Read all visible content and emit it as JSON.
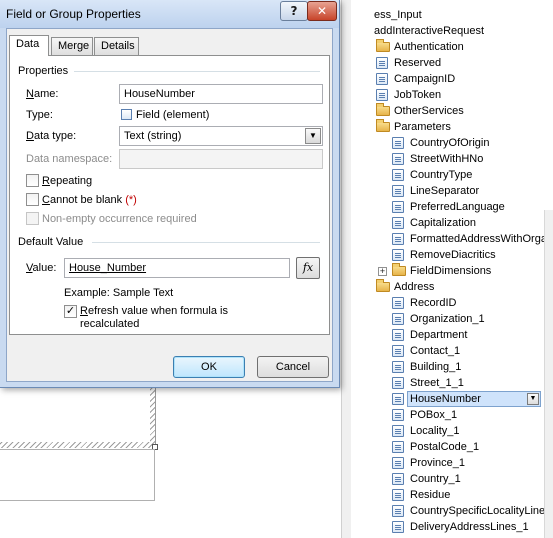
{
  "dialog": {
    "title": "Field or Group Properties",
    "help_glyph": "?",
    "close_glyph": "✕",
    "tabs": [
      "Data",
      "Merge",
      "Details"
    ],
    "properties_header": "Properties",
    "name": {
      "label_u": "N",
      "label_rest": "ame:",
      "value": "HouseNumber"
    },
    "type": {
      "label": "Type:",
      "value": "Field (element)"
    },
    "data_type": {
      "label_u": "D",
      "label_rest": "ata type:",
      "value": "Text (string)"
    },
    "data_namespace": {
      "label": "Data namespace:",
      "value": ""
    },
    "repeating": {
      "label_u": "R",
      "label_rest": "epeating",
      "checked": false
    },
    "cannot_be_blank": {
      "label_u": "C",
      "label_rest": "annot be blank",
      "marker": "(*)",
      "checked": false
    },
    "non_empty": {
      "label": "Non-empty occurrence required",
      "checked": false
    },
    "default_value_header": "Default Value",
    "value": {
      "label_u": "V",
      "label_rest": "alue:",
      "value": "House_Number"
    },
    "fx_label": "fx",
    "example": "Example: Sample Text",
    "refresh": {
      "label_u": "R",
      "label_rest": "efresh value when formula is recalculated",
      "checked": true
    },
    "ok_label": "OK",
    "cancel_label": "Cancel"
  },
  "tree": {
    "items": [
      {
        "label": "ess_Input",
        "icon": "none",
        "level": 0
      },
      {
        "label": "addInteractiveRequest",
        "icon": "none",
        "level": 0
      },
      {
        "label": "Authentication",
        "icon": "folder",
        "level": 0
      },
      {
        "label": "Reserved",
        "icon": "field",
        "level": 0
      },
      {
        "label": "CampaignID",
        "icon": "field",
        "level": 0
      },
      {
        "label": "JobToken",
        "icon": "field",
        "level": 0
      },
      {
        "label": "OtherServices",
        "icon": "folder",
        "level": 0
      },
      {
        "label": "Parameters",
        "icon": "folder",
        "level": 0
      },
      {
        "label": "CountryOfOrigin",
        "icon": "field",
        "level": 1
      },
      {
        "label": "StreetWithHNo",
        "icon": "field",
        "level": 1
      },
      {
        "label": "CountryType",
        "icon": "field",
        "level": 1
      },
      {
        "label": "LineSeparator",
        "icon": "field",
        "level": 1
      },
      {
        "label": "PreferredLanguage",
        "icon": "field",
        "level": 1
      },
      {
        "label": "Capitalization",
        "icon": "field",
        "level": 1
      },
      {
        "label": "FormattedAddressWithOrga",
        "icon": "field",
        "level": 1
      },
      {
        "label": "RemoveDiacritics",
        "icon": "field",
        "level": 1
      },
      {
        "label": "FieldDimensions",
        "icon": "folder",
        "level": 1,
        "expander": "+"
      },
      {
        "label": "Address",
        "icon": "folder",
        "level": 0
      },
      {
        "label": "RecordID",
        "icon": "field",
        "level": 1
      },
      {
        "label": "Organization_1",
        "icon": "field",
        "level": 1
      },
      {
        "label": "Department",
        "icon": "field",
        "level": 1
      },
      {
        "label": "Contact_1",
        "icon": "field",
        "level": 1
      },
      {
        "label": "Building_1",
        "icon": "field",
        "level": 1
      },
      {
        "label": "Street_1_1",
        "icon": "field",
        "level": 1
      },
      {
        "label": "HouseNumber",
        "icon": "field",
        "level": 1,
        "selected": true
      },
      {
        "label": "POBox_1",
        "icon": "field",
        "level": 1
      },
      {
        "label": "Locality_1",
        "icon": "field",
        "level": 1
      },
      {
        "label": "PostalCode_1",
        "icon": "field",
        "level": 1
      },
      {
        "label": "Province_1",
        "icon": "field",
        "level": 1
      },
      {
        "label": "Country_1",
        "icon": "field",
        "level": 1
      },
      {
        "label": "Residue",
        "icon": "field",
        "level": 1
      },
      {
        "label": "CountrySpecificLocalityLine_",
        "icon": "field",
        "level": 1
      },
      {
        "label": "DeliveryAddressLines_1",
        "icon": "field",
        "level": 1
      }
    ],
    "selected_drop_glyph": "▼"
  }
}
